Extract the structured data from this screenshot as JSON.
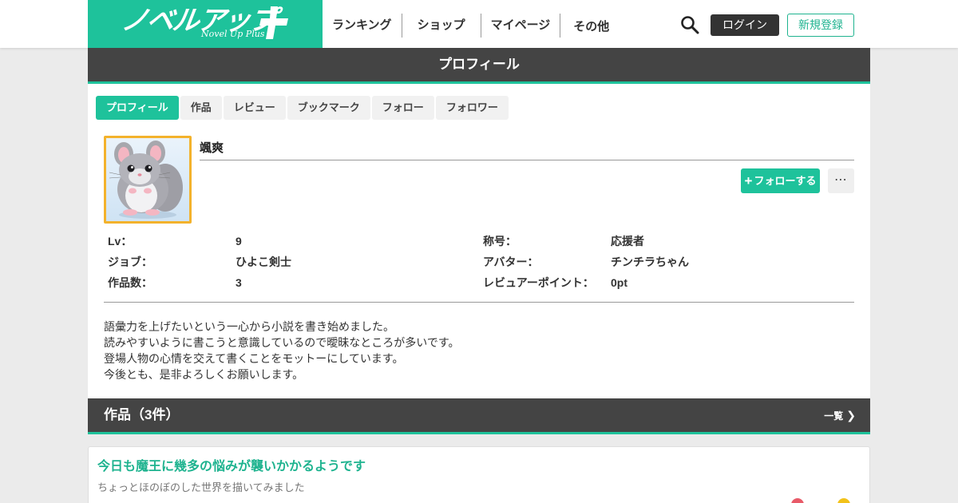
{
  "header": {
    "logo_text": "ノベルアップ",
    "logo_sub": "Novel Up Plus",
    "nav": [
      "ランキング",
      "ショップ",
      "マイページ",
      "その他"
    ],
    "login_label": "ログイン",
    "register_label": "新規登録",
    "search_icon": "search-icon"
  },
  "profile": {
    "bar_title": "プロフィール",
    "tabs": [
      "プロフィール",
      "作品",
      "レビュー",
      "ブックマーク",
      "フォロー",
      "フォロワー"
    ],
    "active_tab": "プロフィール",
    "username": "颯爽",
    "follow_label": "フォローする",
    "more_label": "⋯",
    "stats_left": [
      {
        "label": "Lv：",
        "value": "9"
      },
      {
        "label": "ジョブ：",
        "value": "ひよこ剣士"
      },
      {
        "label": "作品数：",
        "value": "3"
      }
    ],
    "stats_right": [
      {
        "label": "称号：",
        "value": "応援者"
      },
      {
        "label": "アバター：",
        "value": "チンチラちゃん"
      },
      {
        "label": "レビュアーポイント：",
        "value": "0pt"
      }
    ],
    "bio": [
      "語彙力を上げたいという一心から小説を書き始めました。",
      "読みやすいように書こうと意識しているので曖昧なところが多いです。",
      "登場人物の心情を交えて書くことをモットーにしています。",
      "今後とも、是非よろしくお願いします。"
    ]
  },
  "works": {
    "bar_title": "作品（3件）",
    "more_label": "一覧",
    "items": [
      {
        "title": "今日も魔王に幾多の悩みが襲いかかるようです",
        "desc": "ちょっとほのぼのした世界を描いてみました"
      }
    ]
  },
  "colors": {
    "accent": "#1ec29b",
    "dark_bar": "#444444",
    "avatar_border": "#f3b22c"
  }
}
